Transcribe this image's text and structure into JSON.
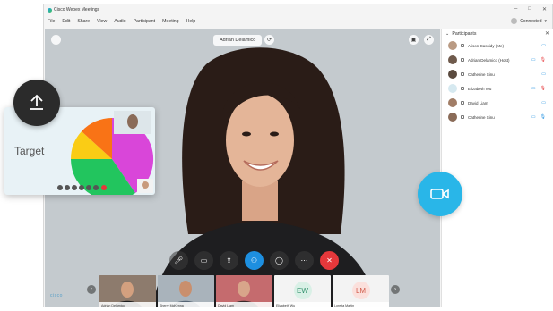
{
  "window": {
    "title": "Cisco Webex Meetings",
    "connection_status": "Connected"
  },
  "menu": [
    "File",
    "Edit",
    "Share",
    "View",
    "Audio",
    "Participant",
    "Meeting",
    "Help"
  ],
  "stage": {
    "active_speaker": "Adrian Delamico"
  },
  "participants_panel": {
    "title": "Participants",
    "items": [
      {
        "name": "Alison Cassidy",
        "role": "(Me)"
      },
      {
        "name": "Adrian Delamico",
        "role": "(Host)"
      },
      {
        "name": "Catherine Sinu",
        "role": ""
      },
      {
        "name": "Elizabeth Wu",
        "role": ""
      },
      {
        "name": "David Liam",
        "role": ""
      },
      {
        "name": "Catherine Sinu",
        "role": ""
      }
    ]
  },
  "filmstrip": [
    {
      "name": "Adrian Delamico",
      "initials": ""
    },
    {
      "name": "Sherry McKenna",
      "initials": ""
    },
    {
      "name": "David Liam",
      "initials": ""
    },
    {
      "name": "Elizabeth Wu",
      "initials": "EW"
    },
    {
      "name": "Loretta Martin",
      "initials": "LM"
    }
  ],
  "share_card": {
    "label": "Target"
  },
  "brand": {
    "mark": "cisco"
  },
  "colors": {
    "accent": "#1d8fe0",
    "end_call": "#e5383b",
    "video_bubble": "#29b6e8",
    "pie": [
      "#d946d9",
      "#22c55e",
      "#facc15",
      "#f97316"
    ]
  },
  "icons": {
    "upload": "upload-arrow-icon",
    "video": "video-camera-icon",
    "mute": "microphone-icon",
    "camera": "camera-icon",
    "share": "share-icon",
    "participants": "participants-icon",
    "chat": "chat-icon",
    "more": "more-icon",
    "end": "close-icon"
  }
}
